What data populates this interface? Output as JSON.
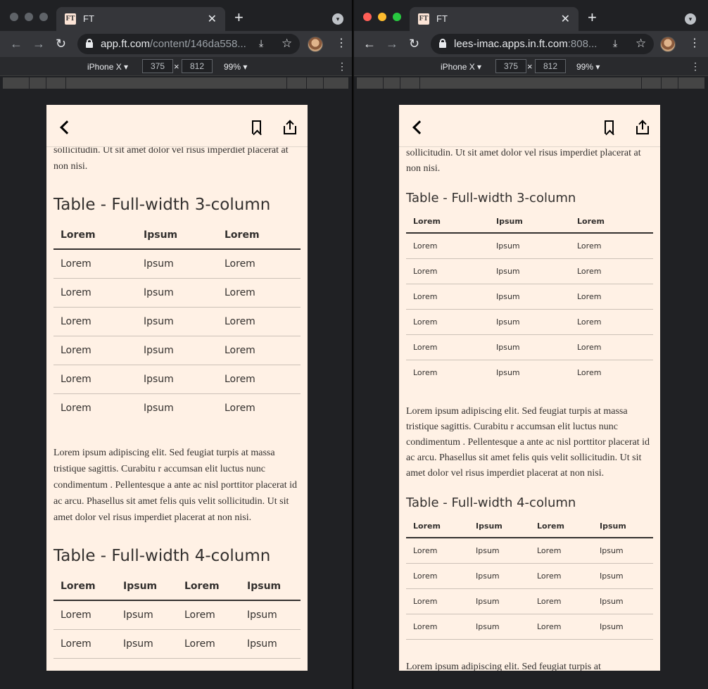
{
  "left": {
    "tab_title": "FT",
    "favicon": "FT",
    "url_main": "app.ft.com",
    "url_rest": "/content/146da558...",
    "device": "iPhone X ▾",
    "width": "375",
    "height": "812",
    "zoom": "99% ▾",
    "article": {
      "para_top": "sollicitudin. Ut sit amet dolor vel risus imperdiet placerat at non nisi.",
      "table3_title": "Table - Full-width 3-column",
      "table3_headers": [
        "Lorem",
        "Ipsum",
        "Lorem"
      ],
      "table3_rows": [
        [
          "Lorem",
          "Ipsum",
          "Lorem"
        ],
        [
          "Lorem",
          "Ipsum",
          "Lorem"
        ],
        [
          "Lorem",
          "Ipsum",
          "Lorem"
        ],
        [
          "Lorem",
          "Ipsum",
          "Lorem"
        ],
        [
          "Lorem",
          "Ipsum",
          "Lorem"
        ],
        [
          "Lorem",
          "Ipsum",
          "Lorem"
        ]
      ],
      "para_mid": "Lorem ipsum adipiscing elit. Sed feugiat turpis at massa tristique sagittis. Curabitu r accumsan elit luctus nunc condimentum . Pellentesque a ante ac nisl porttitor placerat id ac arcu. Phasellus sit amet felis quis velit sollicitudin. Ut sit amet dolor vel risus imperdiet placerat at non nisi.",
      "table4_title": "Table - Full-width 4-column",
      "table4_headers": [
        "Lorem",
        "Ipsum",
        "Lorem",
        "Ipsum"
      ],
      "table4_rows": [
        [
          "Lorem",
          "Ipsum",
          "Lorem",
          "Ipsum"
        ],
        [
          "Lorem",
          "Ipsum",
          "Lorem",
          "Ipsum"
        ]
      ]
    }
  },
  "right": {
    "tab_title": "FT",
    "favicon": "FT",
    "url_main": "lees-imac.apps.in.ft.com",
    "url_rest": ":808...",
    "device": "iPhone X ▾",
    "width": "375",
    "height": "812",
    "zoom": "99% ▾",
    "article": {
      "para_top": "sollicitudin. Ut sit amet dolor vel risus imperdiet placerat at non nisi.",
      "table3_title": "Table - Full-width 3-column",
      "table3_headers": [
        "Lorem",
        "Ipsum",
        "Lorem"
      ],
      "table3_rows": [
        [
          "Lorem",
          "Ipsum",
          "Lorem"
        ],
        [
          "Lorem",
          "Ipsum",
          "Lorem"
        ],
        [
          "Lorem",
          "Ipsum",
          "Lorem"
        ],
        [
          "Lorem",
          "Ipsum",
          "Lorem"
        ],
        [
          "Lorem",
          "Ipsum",
          "Lorem"
        ],
        [
          "Lorem",
          "Ipsum",
          "Lorem"
        ]
      ],
      "para_mid": "Lorem ipsum adipiscing elit. Sed feugiat turpis at massa tristique sagittis. Curabitu r accumsan elit luctus nunc condimentum . Pellentesque a ante ac nisl porttitor placerat id ac arcu. Phasellus sit amet felis quis velit sollicitudin. Ut sit amet dolor vel risus imperdiet placerat at non nisi.",
      "table4_title": "Table - Full-width 4-column",
      "table4_headers": [
        "Lorem",
        "Ipsum",
        "Lorem",
        "Ipsum"
      ],
      "table4_rows": [
        [
          "Lorem",
          "Ipsum",
          "Lorem",
          "Ipsum"
        ],
        [
          "Lorem",
          "Ipsum",
          "Lorem",
          "Ipsum"
        ],
        [
          "Lorem",
          "Ipsum",
          "Lorem",
          "Ipsum"
        ],
        [
          "Lorem",
          "Ipsum",
          "Lorem",
          "Ipsum"
        ]
      ],
      "para_bottom": "Lorem ipsum adipiscing elit. Sed feugiat turpis at"
    }
  },
  "glyphs": {
    "close": "✕",
    "plus": "+",
    "back": "←",
    "forward": "→",
    "reload": "↻",
    "install": "⤓",
    "star": "☆",
    "kebab": "⋮",
    "times": "×",
    "tabsearch": "▾"
  },
  "colors": {
    "page_bg": "#fff1e5",
    "mac_red": "#ff5f57",
    "mac_yellow": "#febc2e",
    "mac_green": "#28c840",
    "mac_inactive": "#5f6368"
  }
}
